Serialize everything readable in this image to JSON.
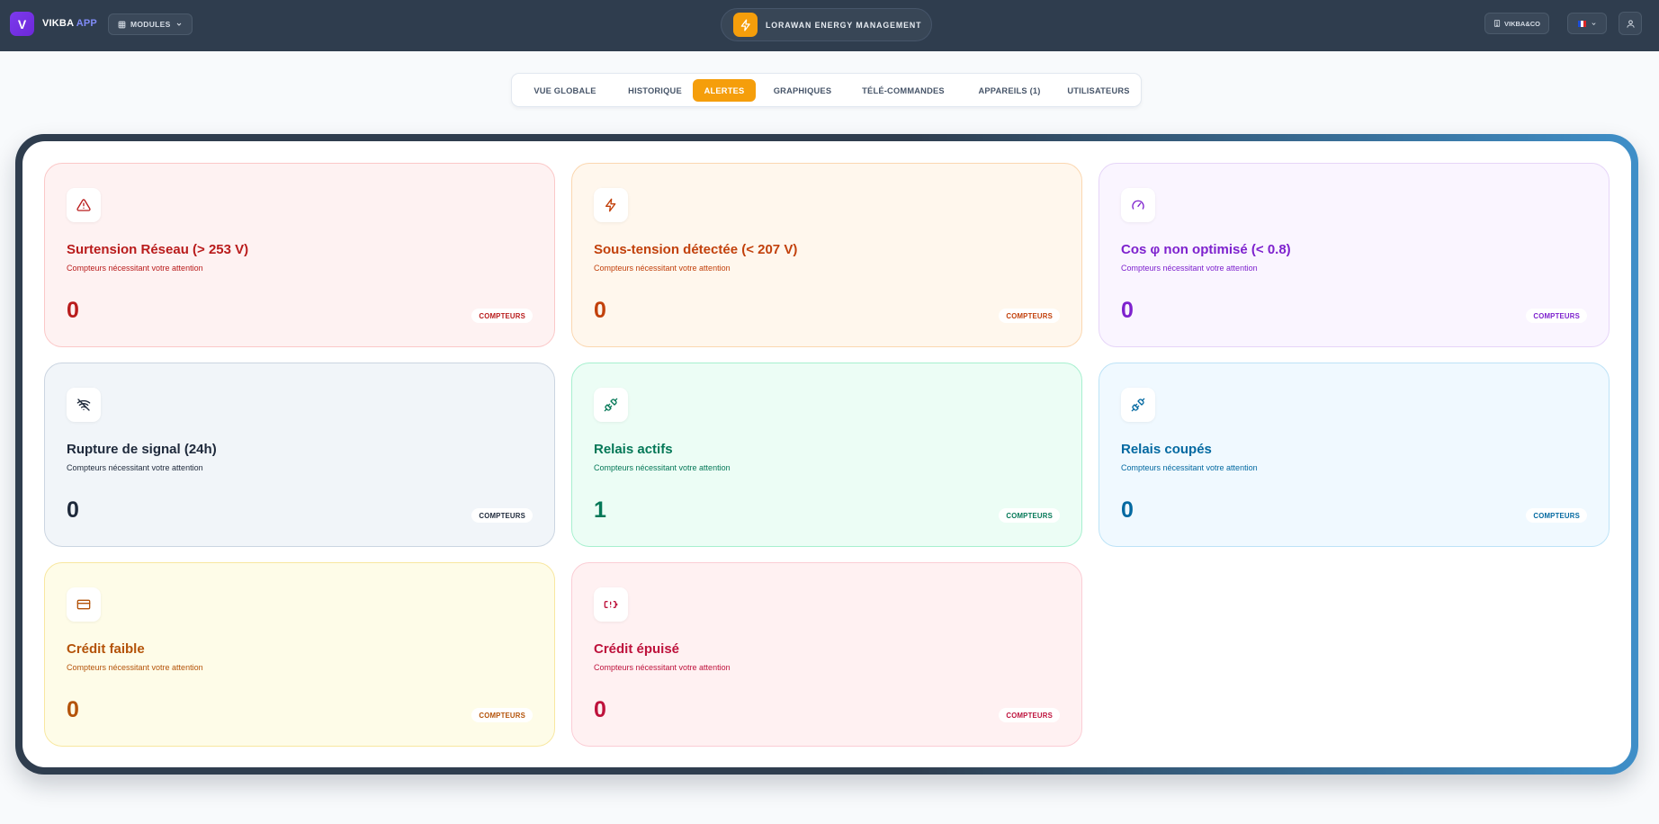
{
  "header": {
    "logo_letter": "V",
    "brand_main": "VIKBA",
    "brand_app": "APP",
    "modules_label": "MODULES",
    "center_title": "LORAWAN ENERGY MANAGEMENT",
    "org_label": "VIKBA&CO",
    "lang_flag": "fr"
  },
  "tabs": [
    {
      "label": "VUE GLOBALE",
      "active": false
    },
    {
      "label": "HISTORIQUE",
      "active": false
    },
    {
      "label": "ALERTES",
      "active": true
    },
    {
      "label": "GRAPHIQUES",
      "active": false
    },
    {
      "label": "TÉLÉ-COMMANDES",
      "active": false
    },
    {
      "label": "APPAREILS (1)",
      "active": false
    },
    {
      "label": "UTILISATEURS",
      "active": false
    }
  ],
  "cards": [
    {
      "icon": "warning-triangle-icon",
      "title": "Surtension Réseau (> 253 V)",
      "subtitle": "Compteurs nécessitant votre attention",
      "value": "0",
      "badge": "COMPTEURS",
      "accent": "#b91c1c",
      "bg": "#fef2f2",
      "border": "#fbc8c8"
    },
    {
      "icon": "bolt-icon",
      "title": "Sous-tension détectée (< 207 V)",
      "subtitle": "Compteurs nécessitant votre attention",
      "value": "0",
      "badge": "COMPTEURS",
      "accent": "#c2410c",
      "bg": "#fff7ed",
      "border": "#fbd7b0"
    },
    {
      "icon": "gauge-icon",
      "title": "Cos φ non optimisé (< 0.8)",
      "subtitle": "Compteurs nécessitant votre attention",
      "value": "0",
      "badge": "COMPTEURS",
      "accent": "#7e22ce",
      "bg": "#faf5ff",
      "border": "#e6d5f8"
    },
    {
      "icon": "wifi-off-icon",
      "title": "Rupture de signal (24h)",
      "subtitle": "Compteurs nécessitant votre attention",
      "value": "0",
      "badge": "COMPTEURS",
      "accent": "#1e293b",
      "bg": "#f1f5f9",
      "border": "#cbd5e1"
    },
    {
      "icon": "plug-icon",
      "title": "Relais actifs",
      "subtitle": "Compteurs nécessitant votre attention",
      "value": "1",
      "badge": "COMPTEURS",
      "accent": "#047857",
      "bg": "#ecfdf5",
      "border": "#a7f0cf"
    },
    {
      "icon": "plug-off-icon",
      "title": "Relais coupés",
      "subtitle": "Compteurs nécessitant votre attention",
      "value": "0",
      "badge": "COMPTEURS",
      "accent": "#0369a1",
      "bg": "#f0f9ff",
      "border": "#bde3f7"
    },
    {
      "icon": "credit-card-icon",
      "title": "Crédit faible",
      "subtitle": "Compteurs nécessitant votre attention",
      "value": "0",
      "badge": "COMPTEURS",
      "accent": "#b45309",
      "bg": "#fefce8",
      "border": "#f8e7a0"
    },
    {
      "icon": "battery-warning-icon",
      "title": "Crédit épuisé",
      "subtitle": "Compteurs nécessitant votre attention",
      "value": "0",
      "badge": "COMPTEURS",
      "accent": "#be123c",
      "bg": "#fff1f2",
      "border": "#fbcdd5"
    }
  ]
}
